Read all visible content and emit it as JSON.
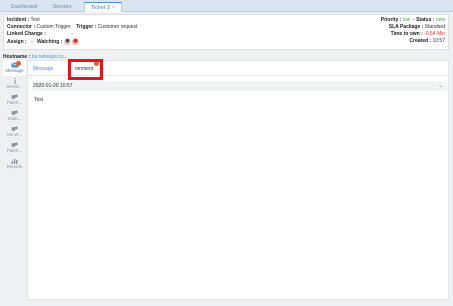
{
  "tabs": [
    {
      "label": "Dashboard"
    },
    {
      "label": "Servers"
    },
    {
      "label": "Ticket 2",
      "close": "×"
    }
  ],
  "header": {
    "incident_label": "Incident :",
    "incident_value": "Test",
    "connector_label": "Connector :",
    "connector_value": "Custom Trigger",
    "trigger_label": "Trigger :",
    "trigger_value": "Customer request",
    "linked_label": "Linked Change :",
    "linked_value": "-",
    "assign_label": "Assign :",
    "assign_value": "-",
    "watching_label": "Watching :",
    "priority_label": "Priority :",
    "priority_value": "low",
    "status_label": "Status :",
    "status_value": "new",
    "sla_label": "SLA Package :",
    "sla_value": "Standard",
    "tto_label": "Time to own :",
    "tto_value": "-0.54 Min",
    "created_label": "Created :",
    "created_value": "10:57"
  },
  "hostname": {
    "label": "Hostname :",
    "value": "lra.netways.co..."
  },
  "sidebar": {
    "items": [
      {
        "label": "Message",
        "icon": "envelope-icon"
      },
      {
        "label": "Servic...",
        "icon": "info-icon"
      },
      {
        "label": "Patch...",
        "icon": "gear-icon"
      },
      {
        "label": "Zabb...",
        "icon": "gear-icon"
      },
      {
        "label": "Ms W...",
        "icon": "gear-icon"
      },
      {
        "label": "Patch...",
        "icon": "gear-icon"
      },
      {
        "label": "Reports",
        "icon": "bar-chart-icon"
      }
    ]
  },
  "subtabs": {
    "message": "Message",
    "comment": "omment"
  },
  "entry": {
    "date": "2020-01-20 10:57",
    "chevron": "⌄",
    "body": "Test"
  },
  "colors": {
    "accent": "#4a90d9",
    "highlight": "#e3141c",
    "green": "#3bb54a",
    "red": "#e0322b"
  }
}
